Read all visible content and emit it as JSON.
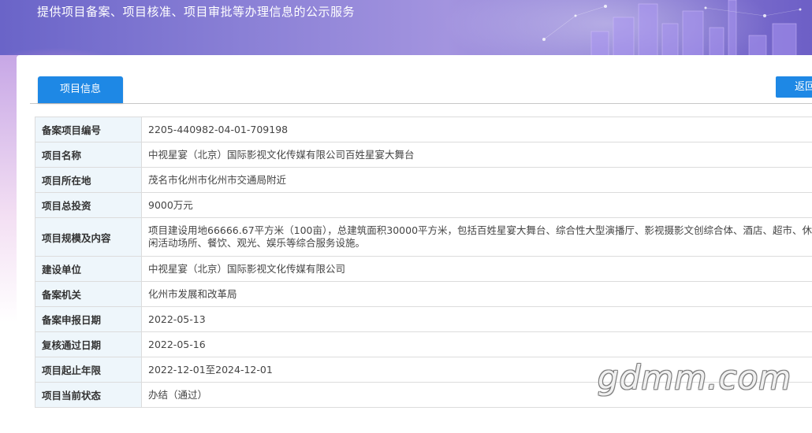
{
  "banner": {
    "subtitle": "提供项目备案、项目核准、项目审批等办理信息的公示服务"
  },
  "tabs": [
    {
      "label": "项目信息",
      "active": true
    }
  ],
  "back_button": {
    "label": "返回"
  },
  "info_rows": [
    {
      "key": "备案项目编号",
      "value": "2205-440982-04-01-709198"
    },
    {
      "key": "项目名称",
      "value": "中视星宴（北京）国际影视文化传媒有限公司百姓星宴大舞台"
    },
    {
      "key": "项目所在地",
      "value": "茂名市化州市化州市交通局附近"
    },
    {
      "key": "项目总投资",
      "value": "9000万元"
    },
    {
      "key": "项目规模及内容",
      "value": "项目建设用地66666.67平方米（100亩），总建筑面积30000平方米，包括百姓星宴大舞台、综合性大型演播厅、影视摄影文创综合体、酒店、超市、休闲活动场所、餐饮、观光、娱乐等综合服务设施。"
    },
    {
      "key": "建设单位",
      "value": "中视星宴（北京）国际影视文化传媒有限公司"
    },
    {
      "key": "备案机关",
      "value": "化州市发展和改革局"
    },
    {
      "key": "备案申报日期",
      "value": "2022-05-13"
    },
    {
      "key": "复核通过日期",
      "value": "2022-05-16"
    },
    {
      "key": "项目起止年限",
      "value": "2022-12-01至2024-12-01"
    },
    {
      "key": "项目当前状态",
      "value": "办结（通过）"
    }
  ],
  "watermark": "gdmm.com",
  "colors": {
    "accent": "#1e88e5",
    "key_cell_bg": "#eef6fb",
    "border": "#dcdcdc"
  }
}
